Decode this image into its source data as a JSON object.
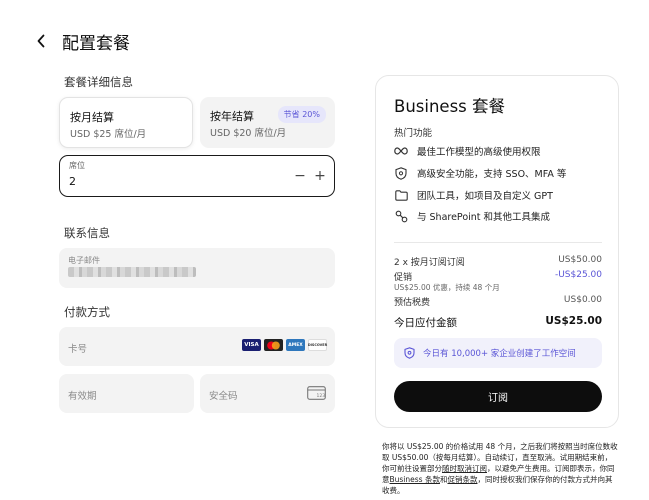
{
  "header": {
    "title": "配置套餐"
  },
  "plan_section": {
    "title": "套餐详细信息",
    "monthly": {
      "name": "按月结算",
      "price": "USD $25 席位/月"
    },
    "yearly": {
      "name": "按年结算",
      "price": "USD $20 席位/月",
      "badge": "节省 20%"
    }
  },
  "seats": {
    "label": "席位",
    "value": "2",
    "minus": "−",
    "plus": "+"
  },
  "contact": {
    "title": "联系信息",
    "email_label": "电子邮件"
  },
  "payment": {
    "title": "付款方式",
    "card_number_placeholder": "卡号",
    "expiry_placeholder": "有效期",
    "cvc_placeholder": "安全码",
    "logos": {
      "visa": "VISA",
      "amex": "AMEX",
      "discover": "DISCOVER"
    }
  },
  "summary": {
    "title": "Business 套餐",
    "features_head": "热门功能",
    "features": [
      {
        "icon": "infinity-icon",
        "text": "最佳工作模型的高级使用权限"
      },
      {
        "icon": "shield-icon",
        "text": "高级安全功能，支持 SSO、MFA 等"
      },
      {
        "icon": "folder-icon",
        "text": "团队工具，如项目及自定义 GPT"
      },
      {
        "icon": "integration-icon",
        "text": "与 SharePoint 和其他工具集成"
      }
    ],
    "lines": {
      "subscription": {
        "label": "2 x 按月订阅订阅",
        "amount": "US$50.00"
      },
      "promo": {
        "label": "促销",
        "amount": "-US$25.00",
        "note": "US$25.00 优惠，持续 48 个月"
      },
      "tax": {
        "label": "预估税费",
        "amount": "US$0.00"
      },
      "total": {
        "label": "今日应付金额",
        "amount": "US$25.00"
      }
    },
    "workspace_note": "今日有 10,000+ 家企业创建了工作空间",
    "subscribe_label": "订阅"
  },
  "legal": {
    "p1": "你将以 US$25.00 的价格试用 48 个月，之后我们将按照当时席位数收取 US$50.00（按每月结算）。自动续订，直至取消。试用期结束前，你可前往设置部分",
    "link_cancel": "随时取消订阅",
    "p2": "，以避免产生费用。订阅即表示，你同意",
    "link_terms": "Business 条款",
    "p3": "和",
    "link_promo": "促销条款",
    "p4": "，同时授权我们保存你的付款方式并向其收费。"
  },
  "colors": {
    "accent": "#5a55d6",
    "dark": "#0d0d0d",
    "field_bg": "#f3f3f3"
  }
}
